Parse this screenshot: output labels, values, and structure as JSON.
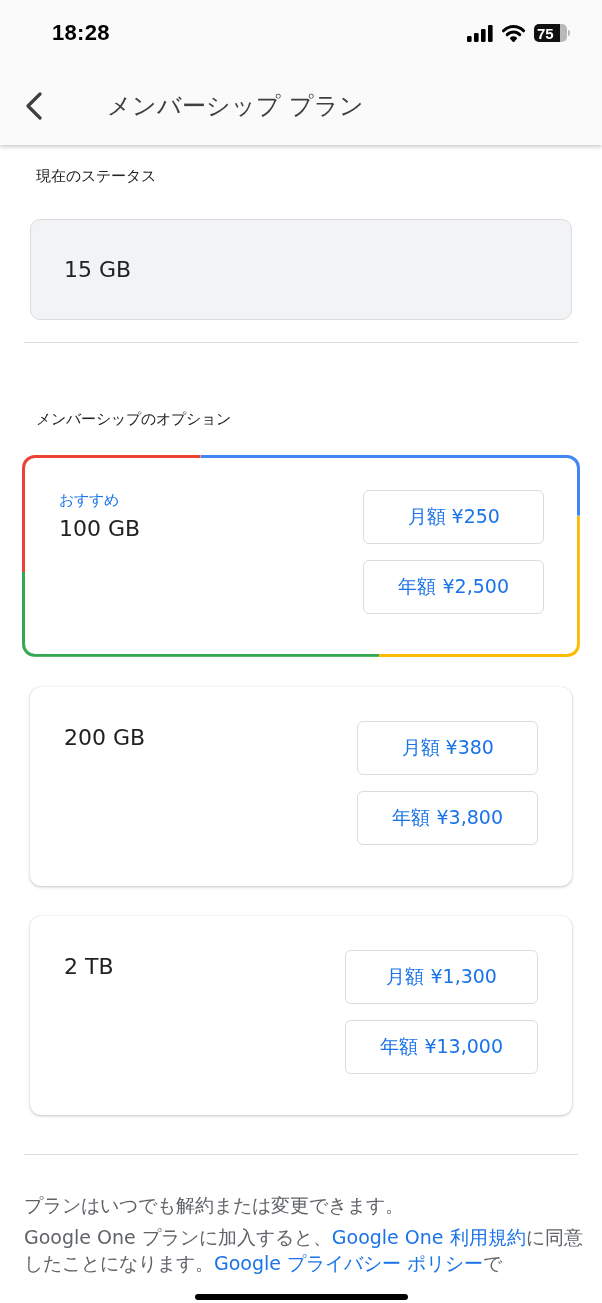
{
  "status_bar": {
    "time": "18:28",
    "battery": "75"
  },
  "header": {
    "title": "メンバーシップ プラン"
  },
  "current_status": {
    "heading": "現在のステータス",
    "storage": "15 GB"
  },
  "options": {
    "heading": "メンバーシップのオプション",
    "plans": [
      {
        "recommended": true,
        "badge": "おすすめ",
        "storage": "100 GB",
        "prices": [
          "月額 ¥250",
          "年額 ¥2,500"
        ]
      },
      {
        "recommended": false,
        "storage": "200 GB",
        "prices": [
          "月額 ¥380",
          "年額 ¥3,800"
        ]
      },
      {
        "recommended": false,
        "storage": "2 TB",
        "prices": [
          "月額 ¥1,300",
          "年額 ¥13,000"
        ]
      }
    ]
  },
  "footer": {
    "note": "プランはいつでも解約または変更できます。",
    "legal": [
      {
        "kind": "text",
        "text": "Google One プランに加入すると、"
      },
      {
        "kind": "link",
        "text": "Google One 利用規約"
      },
      {
        "kind": "text",
        "text": "に同意したことになります。"
      },
      {
        "kind": "link",
        "text": "Google プライバシー ポリシー"
      },
      {
        "kind": "text",
        "text": "で"
      }
    ]
  }
}
